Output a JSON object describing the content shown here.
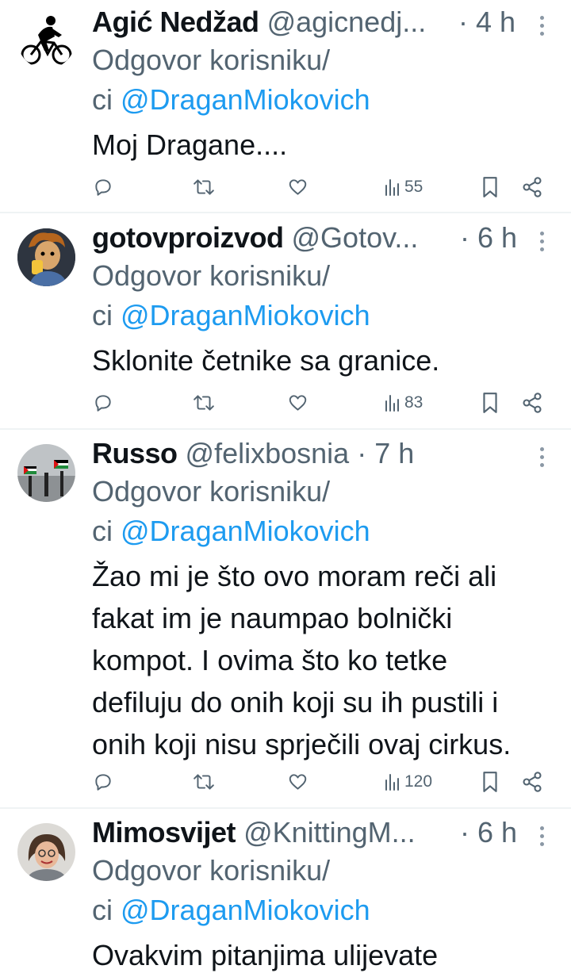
{
  "reply_prefix": "Odgovor korisniku/",
  "reply_prefix2": "ci",
  "tweets": [
    {
      "name": "Agić Nedžad",
      "handle": "@agicnedj...",
      "time": "· 4 h",
      "reply_to": "@DraganMiokovich",
      "text": "Moj Dragane....",
      "views": "55",
      "avatar_icon": "cyclist-silhouette-icon"
    },
    {
      "name": "gotovproizvod",
      "handle": "@Gotov...",
      "time": "· 6 h",
      "reply_to": "@DraganMiokovich",
      "text": "Sklonite četnike sa granice.",
      "views": "83",
      "avatar_icon": "cartoon-character-avatar"
    },
    {
      "name": "Russo",
      "handle": "@felixbosnia",
      "time": "· 7 h",
      "reply_to": "@DraganMiokovich",
      "text": "Žao mi je što ovo moram reči ali fakat im je naumpao bolnički kompot. I ovima što ko tetke defiluju do onih koji su ih pustili i onih koji nisu sprječili ovaj cirkus.",
      "text_lines": [
        "Žao mi je što ovo moram reči ali",
        "fakat im je naumpao bolnički",
        "kompot. I ovima što ko tetke",
        "defiluju do onih koji su ih pustili i",
        "onih koji nisu sprječili ovaj cirkus."
      ],
      "views": "120",
      "avatar_icon": "flags-crowd-avatar"
    },
    {
      "name": "Mimosvijet",
      "handle": "@KnittingM...",
      "time": "· 6 h",
      "reply_to": "@DraganMiokovich",
      "text": "Ovakvim pitanjima ulijevate",
      "views": "",
      "avatar_icon": "woman-portrait-avatar"
    }
  ],
  "colors": {
    "text": "#0f1419",
    "secondary": "#536471",
    "accent": "#1d9bf0",
    "divider": "#eff3f4"
  }
}
